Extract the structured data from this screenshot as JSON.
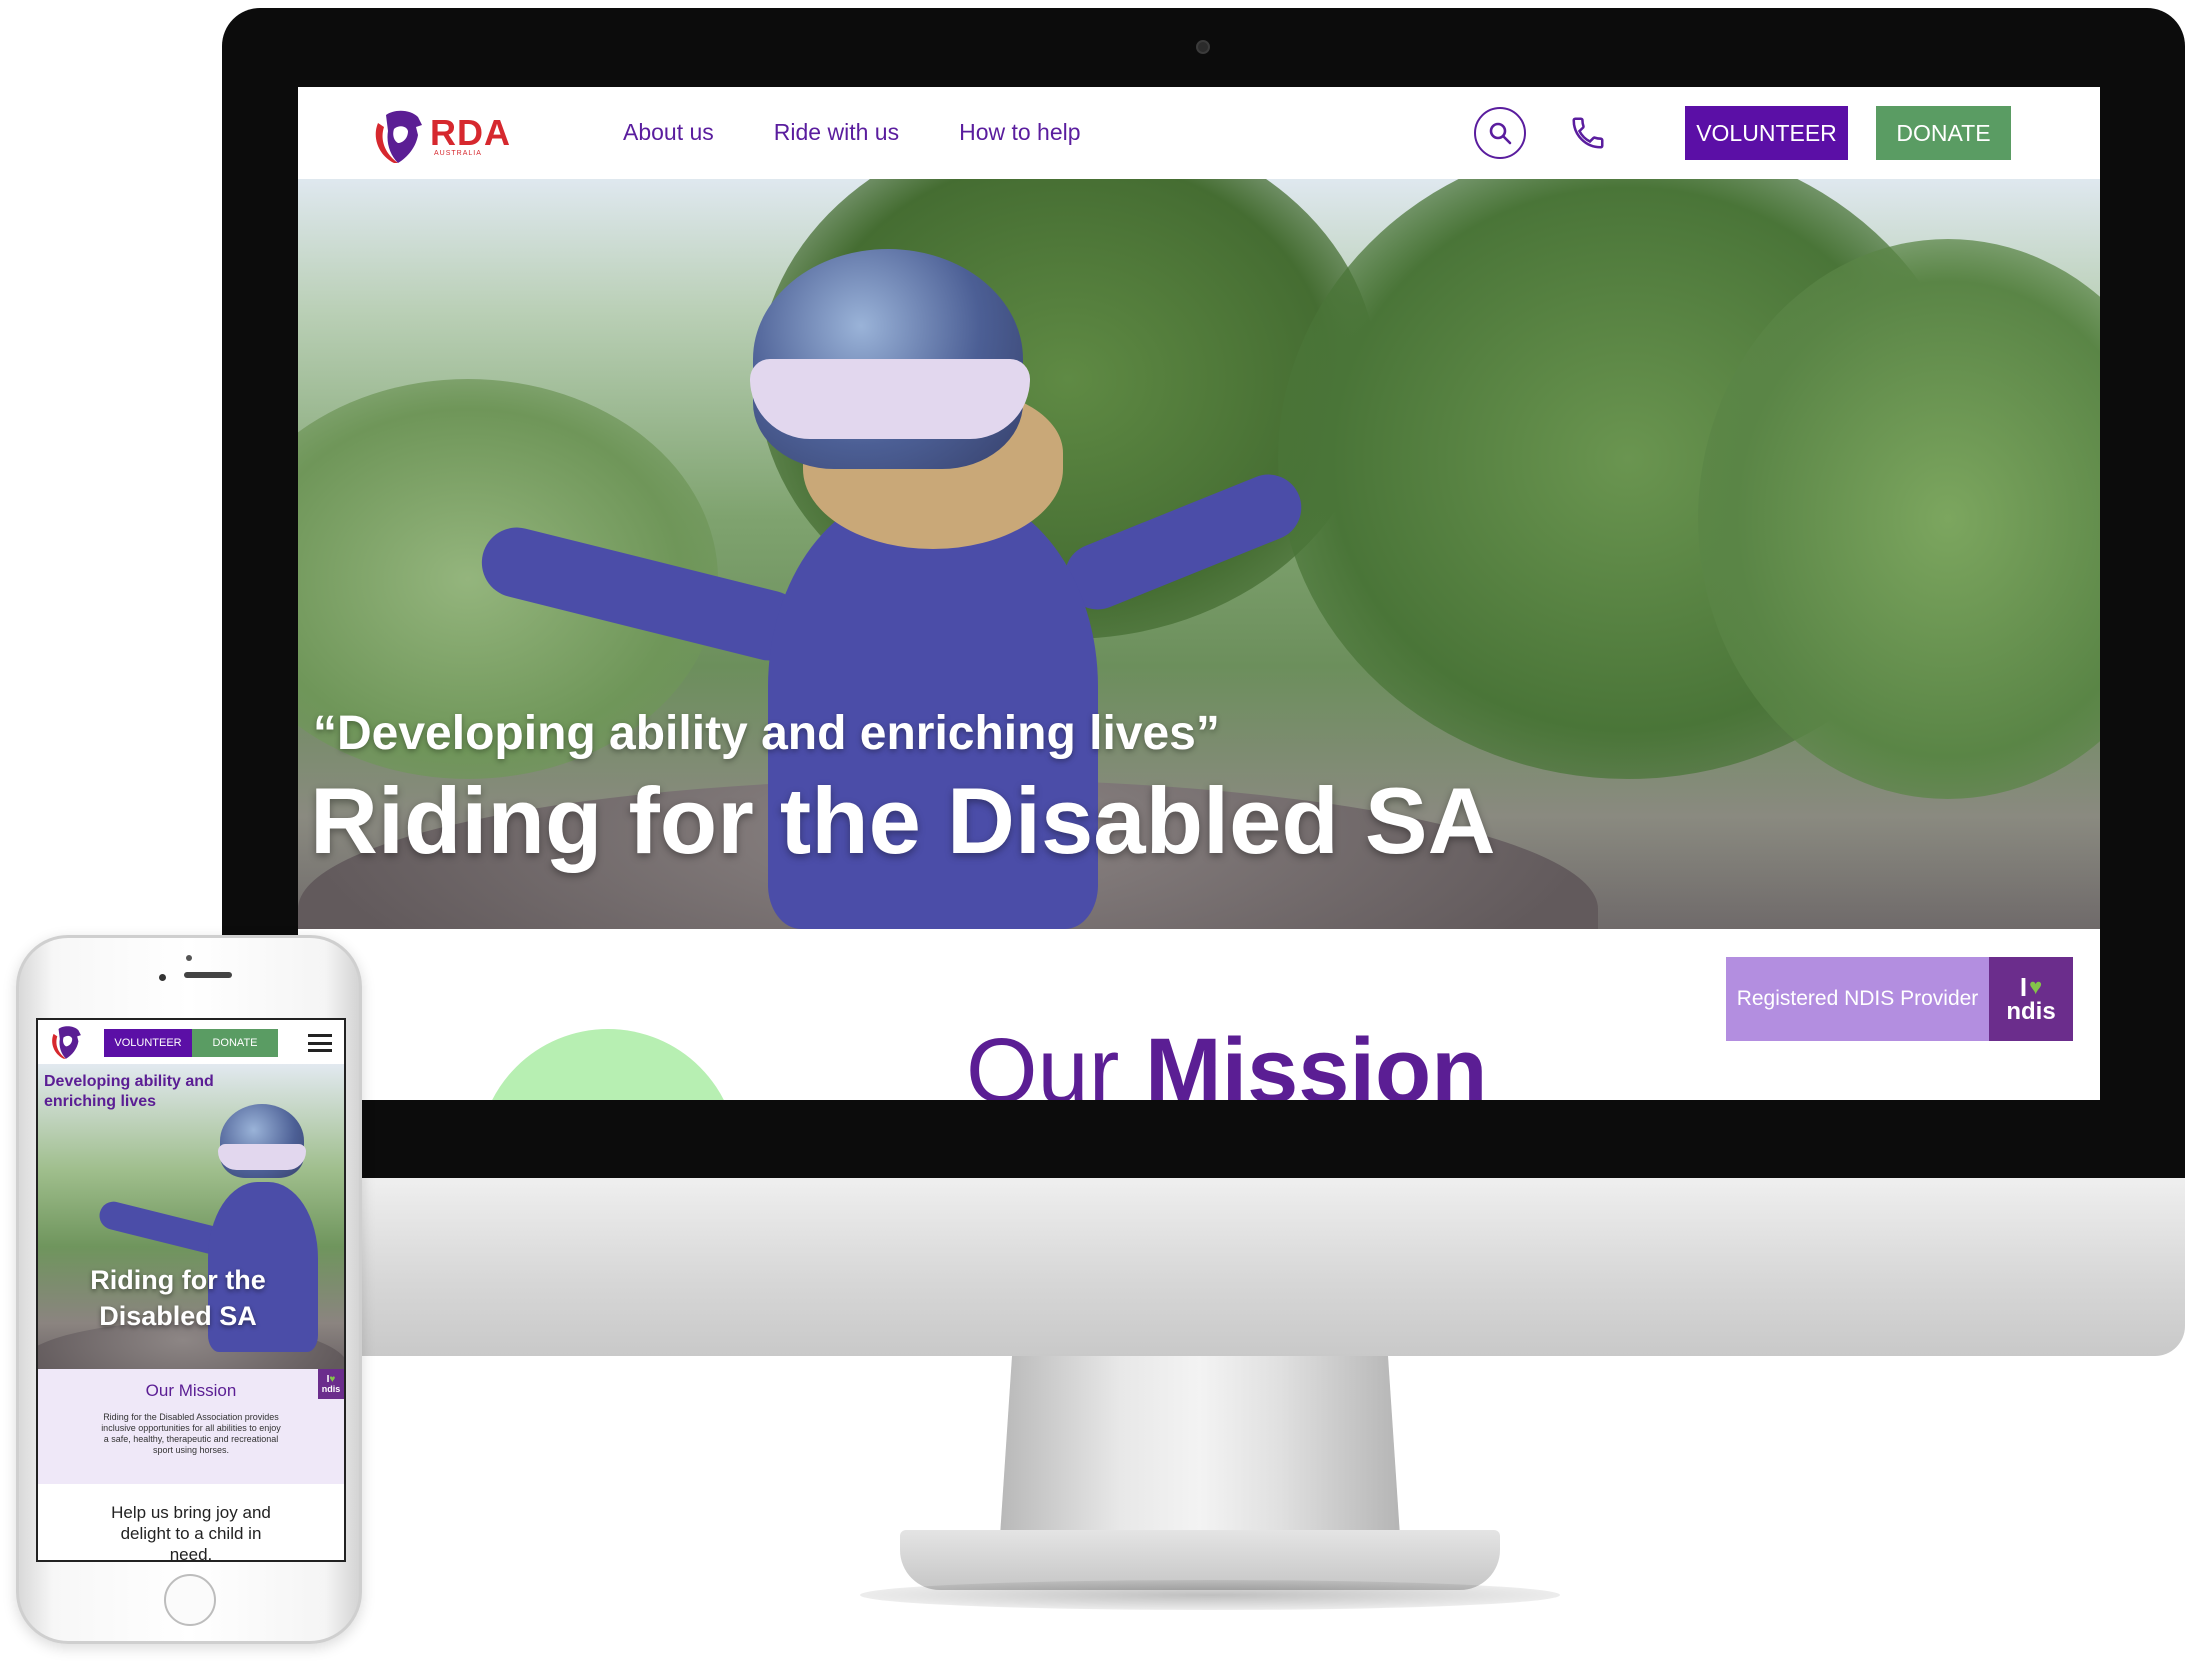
{
  "desktop": {
    "header": {
      "logo_text": "RDA",
      "logo_subtext": "AUSTRALIA",
      "nav": [
        {
          "label": "About us"
        },
        {
          "label": "Ride with us"
        },
        {
          "label": "How to help"
        }
      ],
      "icons": [
        "search-icon",
        "phone-icon"
      ],
      "volunteer_label": "VOLUNTEER",
      "donate_label": "DONATE"
    },
    "hero": {
      "quote": "“Developing ability and enriching lives”",
      "title": "Riding for the Disabled SA"
    },
    "ndis_badge": {
      "label": "Registered NDIS Provider",
      "logo_i": "I",
      "logo_word": "ndis"
    },
    "mission": {
      "title_light": "Our",
      "title_bold": "Mission"
    }
  },
  "mobile": {
    "header": {
      "volunteer_label": "VOLUNTEER",
      "donate_label": "DONATE",
      "menu_icon": "hamburger-icon"
    },
    "hero": {
      "quote": "Developing ability and enriching lives",
      "title": "Riding for the Disabled SA"
    },
    "ndis_logo": {
      "logo_i": "I",
      "logo_word": "ndis"
    },
    "mission": {
      "title": "Our Mission",
      "text": "Riding for the Disabled Association provides inclusive opportunities for all abilities to enjoy a safe, healthy, therapeutic and recreational sport using horses."
    },
    "help": {
      "text": "Help us bring joy and delight to a child in need."
    }
  },
  "colors": {
    "brand_purple": "#5b0fa6",
    "brand_green": "#5a9c63",
    "logo_red": "#d6282e",
    "ndis_purple": "#6b2d8c",
    "ndis_light": "#b38ee0",
    "mission_circle": "#b7efb2"
  }
}
